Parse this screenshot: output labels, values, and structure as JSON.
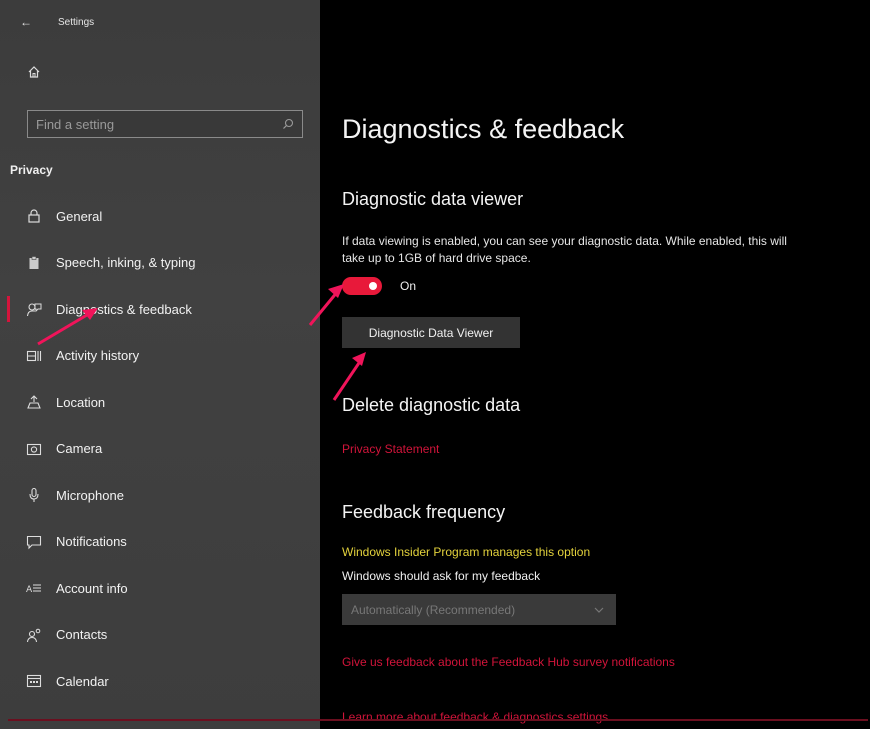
{
  "window": {
    "title": "Settings"
  },
  "sidebar": {
    "search_placeholder": "Find a setting",
    "section": "Privacy",
    "items": [
      {
        "label": "General",
        "icon": "lock-icon"
      },
      {
        "label": "Speech, inking, & typing",
        "icon": "clipboard-icon"
      },
      {
        "label": "Diagnostics & feedback",
        "icon": "feedback-icon",
        "active": true
      },
      {
        "label": "Activity history",
        "icon": "timeline-icon"
      },
      {
        "label": "Location",
        "icon": "location-icon"
      },
      {
        "label": "Camera",
        "icon": "camera-icon"
      },
      {
        "label": "Microphone",
        "icon": "microphone-icon"
      },
      {
        "label": "Notifications",
        "icon": "notification-icon"
      },
      {
        "label": "Account info",
        "icon": "account-info-icon"
      },
      {
        "label": "Contacts",
        "icon": "contacts-icon"
      },
      {
        "label": "Calendar",
        "icon": "calendar-icon"
      }
    ]
  },
  "main": {
    "title": "Diagnostics & feedback",
    "viewer": {
      "heading": "Diagnostic data viewer",
      "description": "If data viewing is enabled, you can see your diagnostic data. While enabled, this will take up to 1GB of hard drive space.",
      "toggle_state": "On",
      "button": "Diagnostic Data Viewer"
    },
    "delete": {
      "heading": "Delete diagnostic data",
      "link": "Privacy Statement"
    },
    "frequency": {
      "heading": "Feedback frequency",
      "insider_note": "Windows Insider Program manages this option",
      "ask_label": "Windows should ask for my feedback",
      "select_value": "Automatically (Recommended)",
      "survey_link": "Give us feedback about the Feedback Hub survey notifications",
      "learn_link": "Learn more about feedback & diagnostics settings"
    }
  },
  "colors": {
    "accent": "#e8193a",
    "link": "#d1143a",
    "note": "#e3d23c",
    "sidebar_bg": "#3e3e3e",
    "main_bg": "#000000"
  }
}
